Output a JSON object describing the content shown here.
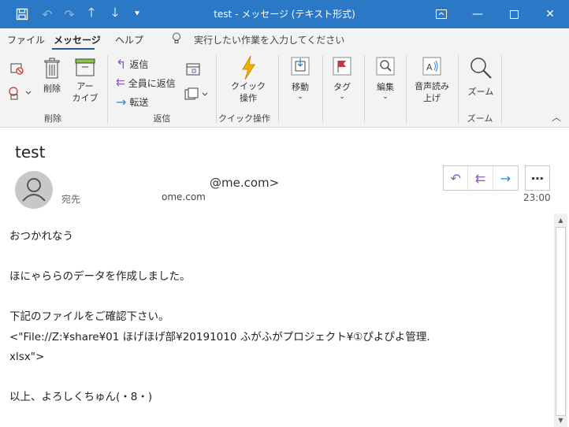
{
  "window": {
    "title": "test  -  メッセージ (テキスト形式)"
  },
  "menu": {
    "tabs": [
      "ファイル",
      "メッセージ",
      "ヘルプ"
    ],
    "tell_me": "実行したい作業を入力してください"
  },
  "ribbon": {
    "delete_group": {
      "delete_label": "削除",
      "archive_label": "アー\nカイブ",
      "group_label": "削除"
    },
    "respond_group": {
      "reply": "返信",
      "reply_all": "全員に返信",
      "forward": "転送",
      "group_label": "返信"
    },
    "quick_group": {
      "quick_steps": "クイック\n操作",
      "group_label": "クイック操作"
    },
    "move": "移動",
    "tags": "タグ",
    "editing": "編集",
    "speech": "音声読み\n上げ",
    "zoom": "ズーム",
    "zoom_group": "ズーム"
  },
  "message": {
    "subject": "test",
    "sender": "@me.com>",
    "to_label": "宛先",
    "to_value": "ome.com",
    "time": "23:00",
    "body": [
      "おつかれなう",
      "",
      "ほにゃららのデータを作成しました。",
      "",
      "下記のファイルをご確認下さい。",
      "<\"File://Z:¥share¥01 ほげほげ部¥20191010 ふがふがプロジェクト¥①ぴよぴよ管理.",
      "xlsx\">",
      "",
      "以上、よろしくちゅん(・8・)"
    ]
  },
  "colors": {
    "titlebar": "#2b78c6",
    "ribbon_bg": "#f3f3f3",
    "reply_purple": "#8a5fb5",
    "forward_blue": "#2b88d8",
    "flag_red": "#d13438",
    "quick_yellow": "#f0b400"
  }
}
